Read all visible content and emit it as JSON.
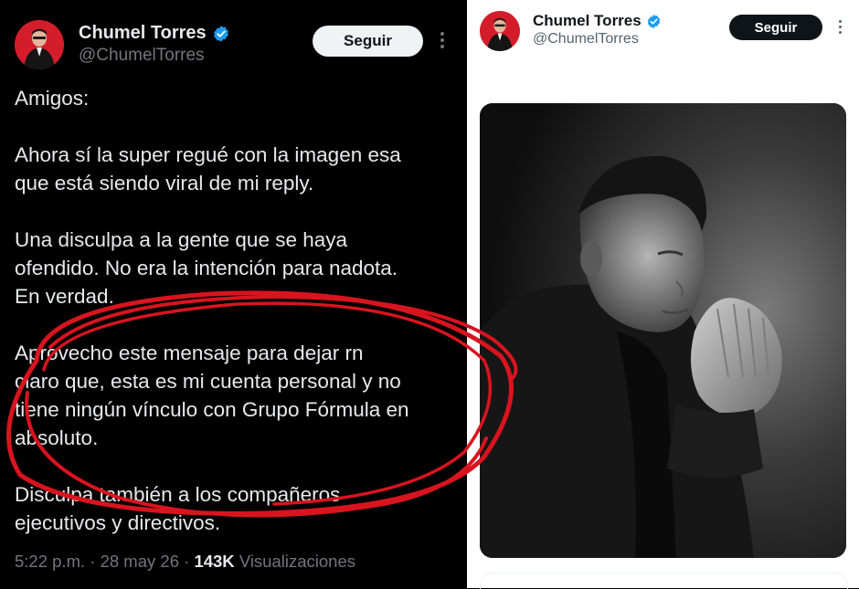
{
  "left_tweet": {
    "author_name": "Chumel Torres",
    "author_handle": "@ChumelTorres",
    "follow_label": "Seguir",
    "paragraphs": [
      "Amigos:",
      "Ahora sí la super regué con la imagen esa\nque está siendo viral de mi reply.",
      "Una disculpa a la gente que se haya\nofendido. No era la intención para nadota.\nEn verdad.",
      "Aprovecho este mensaje para dejar rn\nclaro que, esta es mi cuenta personal y no\ntiene ningún vínculo con Grupo Fórmula en\nabsoluto.",
      "Disculpa también a los compañeros\nejecutivos y directivos."
    ],
    "time": "5:22 p.m.",
    "separator": "·",
    "date": "28 may 26",
    "views_count": "143K",
    "views_label": "Visualizaciones"
  },
  "right_tweet": {
    "author_name": "Chumel Torres",
    "author_handle": "@ChumelTorres",
    "follow_label": "Seguir"
  },
  "colors": {
    "dark_bg": "#000000",
    "light_bg": "#ffffff",
    "verified_badge": "#1d9bf0",
    "highlight_circle": "#d8141f",
    "avatar_bg": "#d41d2a"
  },
  "icons": [
    "verified-badge-icon",
    "more-options-icon"
  ]
}
